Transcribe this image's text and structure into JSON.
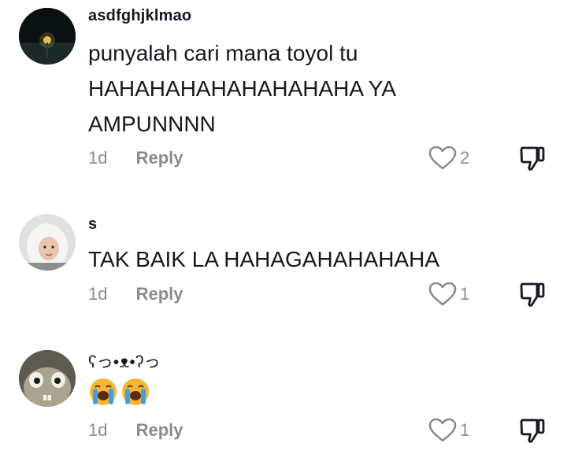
{
  "comments": [
    {
      "username": "asdfghjklmao",
      "text": "punyalah cari mana toyol tu HAHAHAHAHAHAHAHAHA YA AMPUNNNN",
      "time": "1d",
      "reply_label": "Reply",
      "likes": "2",
      "avatar_icon": "night-candle-avatar"
    },
    {
      "username": "s",
      "text": "TAK BAIK LA HAHAGAHAHAHAHA",
      "time": "1d",
      "reply_label": "Reply",
      "likes": "1",
      "avatar_icon": "hijab-girl-avatar"
    },
    {
      "username": "ʕっ•ᴥ•ʔっ",
      "emojis": [
        "loudly-crying-face-icon",
        "loudly-crying-face-icon"
      ],
      "time": "1d",
      "reply_label": "Reply",
      "likes": "1",
      "avatar_icon": "rabbid-avatar"
    }
  ],
  "colors": {
    "text": "#161823",
    "muted": "#8a8b91"
  }
}
